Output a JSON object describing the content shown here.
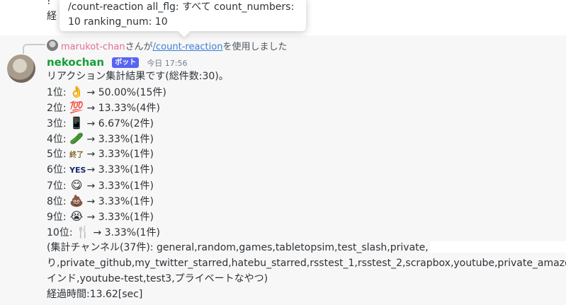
{
  "tooltip": {
    "line1_a": "/count-reaction all_flg: ",
    "line1_b": "すべて",
    "line1_c": " count_numbers:",
    "line2": "10 ranking_num: 10"
  },
  "ghost": {
    "line1": "!",
    "line2": "経"
  },
  "reply": {
    "user": "marukot-chan",
    "connector": "さんが",
    "command": "/count-reaction",
    "suffix": "を使用しました"
  },
  "message": {
    "author": "nekochan",
    "bot_tag": "ボット",
    "timestamp": "今日 17:56",
    "summary": "リアクション集計結果です(総件数:30)。",
    "results": [
      {
        "rank": "1位:",
        "emoji": "👌",
        "text": "→ 50.00%(15件)"
      },
      {
        "rank": "2位:",
        "emoji": "💯",
        "text": "→ 13.33%(4件)"
      },
      {
        "rank": "3位:",
        "emoji": "📱",
        "text": "→ 6.67%(2件)"
      },
      {
        "rank": "4位:",
        "emoji": "🥒",
        "text": "→ 3.33%(1件)"
      },
      {
        "rank": "5位:",
        "emoji": "終了",
        "text": "→ 3.33%(1件)"
      },
      {
        "rank": "6位:",
        "emoji": "YES",
        "text": "→ 3.33%(1件)"
      },
      {
        "rank": "7位:",
        "emoji": "😋",
        "text": "→ 3.33%(1件)"
      },
      {
        "rank": "8位:",
        "emoji": "💩",
        "text": "→ 3.33%(1件)"
      },
      {
        "rank": "9位:",
        "emoji": "😭",
        "text": "→ 3.33%(1件)"
      },
      {
        "rank": "10位:",
        "emoji": "🍴",
        "text": "→ 3.33%(1件)"
      }
    ],
    "channels_line1": "(集計チャンネル(37件): general,random,games,tabletopsim,test_slash,private,",
    "channels_line2": "り,private_github,my_twitter_starred,hatebu_starred,rsstest_1,rsstest_2,scrapbox,youtube,private_amazon,tre",
    "channels_line3": "インド,youtube-test,test3,プライベートなやつ)",
    "elapsed": "経過時間:13.62[sec]"
  }
}
